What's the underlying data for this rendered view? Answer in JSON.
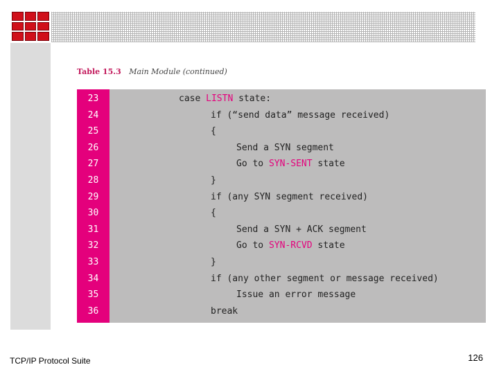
{
  "header": {
    "logo_name": "red-grid-logo",
    "banner_pattern": "hatched-gray"
  },
  "table": {
    "number": "Table 15.3",
    "title": "Main Module (continued)",
    "rows": [
      {
        "num": "23",
        "indent": 0,
        "parts": [
          {
            "t": "case "
          },
          {
            "t": "LISTN",
            "hl": true
          },
          {
            "t": " state:"
          }
        ]
      },
      {
        "num": "24",
        "indent": 1,
        "parts": [
          {
            "t": "if (“send data” message received)"
          }
        ]
      },
      {
        "num": "25",
        "indent": 1,
        "parts": [
          {
            "t": "{"
          }
        ]
      },
      {
        "num": "26",
        "indent": 2,
        "parts": [
          {
            "t": "Send a SYN segment"
          }
        ]
      },
      {
        "num": "27",
        "indent": 2,
        "parts": [
          {
            "t": "Go to "
          },
          {
            "t": "SYN-SENT",
            "hl": true
          },
          {
            "t": " state"
          }
        ]
      },
      {
        "num": "28",
        "indent": 1,
        "parts": [
          {
            "t": "}"
          }
        ]
      },
      {
        "num": "29",
        "indent": 1,
        "parts": [
          {
            "t": "if (any SYN segment received)"
          }
        ]
      },
      {
        "num": "30",
        "indent": 1,
        "parts": [
          {
            "t": "{"
          }
        ]
      },
      {
        "num": "31",
        "indent": 2,
        "parts": [
          {
            "t": "Send a SYN + ACK segment"
          }
        ]
      },
      {
        "num": "32",
        "indent": 2,
        "parts": [
          {
            "t": "Go to "
          },
          {
            "t": "SYN-RCVD",
            "hl": true
          },
          {
            "t": " state"
          }
        ]
      },
      {
        "num": "33",
        "indent": 1,
        "parts": [
          {
            "t": "}"
          }
        ]
      },
      {
        "num": "34",
        "indent": 1,
        "parts": [
          {
            "t": "if (any other segment or message received)"
          }
        ]
      },
      {
        "num": "35",
        "indent": 2,
        "parts": [
          {
            "t": "Issue an error message"
          }
        ]
      },
      {
        "num": "36",
        "indent": 1,
        "parts": [
          {
            "t": "break"
          }
        ]
      }
    ]
  },
  "footer": {
    "left": "TCP/IP Protocol Suite",
    "page": "126"
  },
  "colors": {
    "accent": "#e4007c",
    "code_bg": "#bdbcbc",
    "logo_red": "#d0101a"
  }
}
